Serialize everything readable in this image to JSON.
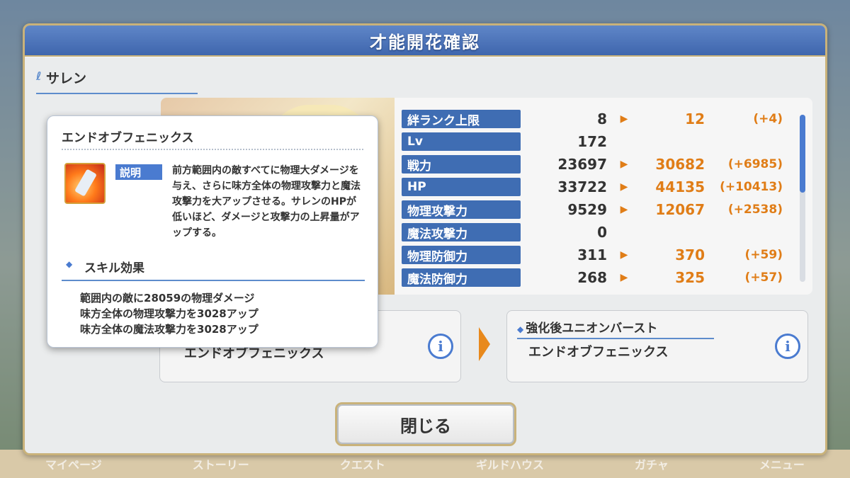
{
  "background": {
    "bottom_nav": [
      "マイページ",
      "ストーリー",
      "クエスト",
      "ギルドハウス",
      "ガチャ",
      "メニュー"
    ]
  },
  "dialog": {
    "title": "才能開花確認",
    "character_name": "サレン",
    "stats": [
      {
        "label": "絆ランク上限",
        "before": "8",
        "after": "12",
        "diff": "(+4)"
      },
      {
        "label": "Lv",
        "before": "172",
        "after": "",
        "diff": ""
      },
      {
        "label": "戦力",
        "before": "23697",
        "after": "30682",
        "diff": "(+6985)"
      },
      {
        "label": "HP",
        "before": "33722",
        "after": "44135",
        "diff": "(+10413)"
      },
      {
        "label": "物理攻撃力",
        "before": "9529",
        "after": "12067",
        "diff": "(+2538)"
      },
      {
        "label": "魔法攻撃力",
        "before": "0",
        "after": "",
        "diff": ""
      },
      {
        "label": "物理防御力",
        "before": "311",
        "after": "370",
        "diff": "(+59)"
      },
      {
        "label": "魔法防御力",
        "before": "268",
        "after": "325",
        "diff": "(+57)"
      }
    ],
    "ub_before_name": "エンドオブフェニックス",
    "ub_after_heading": "強化後ユニオンバースト",
    "ub_after_name": "エンドオブフェニックス",
    "close_label": "閉じる"
  },
  "popup": {
    "title": "エンドオブフェニックス",
    "desc_tag": "説明",
    "description": "前方範囲内の敵すべてに物理大ダメージを与え、さらに味方全体の物理攻撃力と魔法攻撃力を大アップさせる。サレンのHPが低いほど、ダメージと攻撃力の上昇量がアップする。",
    "effects_heading": "スキル効果",
    "effects": [
      "範囲内の敵に28059の物理ダメージ",
      "味方全体の物理攻撃力を3028アップ",
      "味方全体の魔法攻撃力を3028アップ"
    ]
  },
  "colors": {
    "accent_blue": "#3f6db3",
    "highlight_orange": "#e07d17",
    "gold_border": "#c9b27a"
  },
  "icons": {
    "info": "info-icon",
    "arrow": "arrow-right-icon",
    "skill": "phoenix-skill-icon"
  }
}
